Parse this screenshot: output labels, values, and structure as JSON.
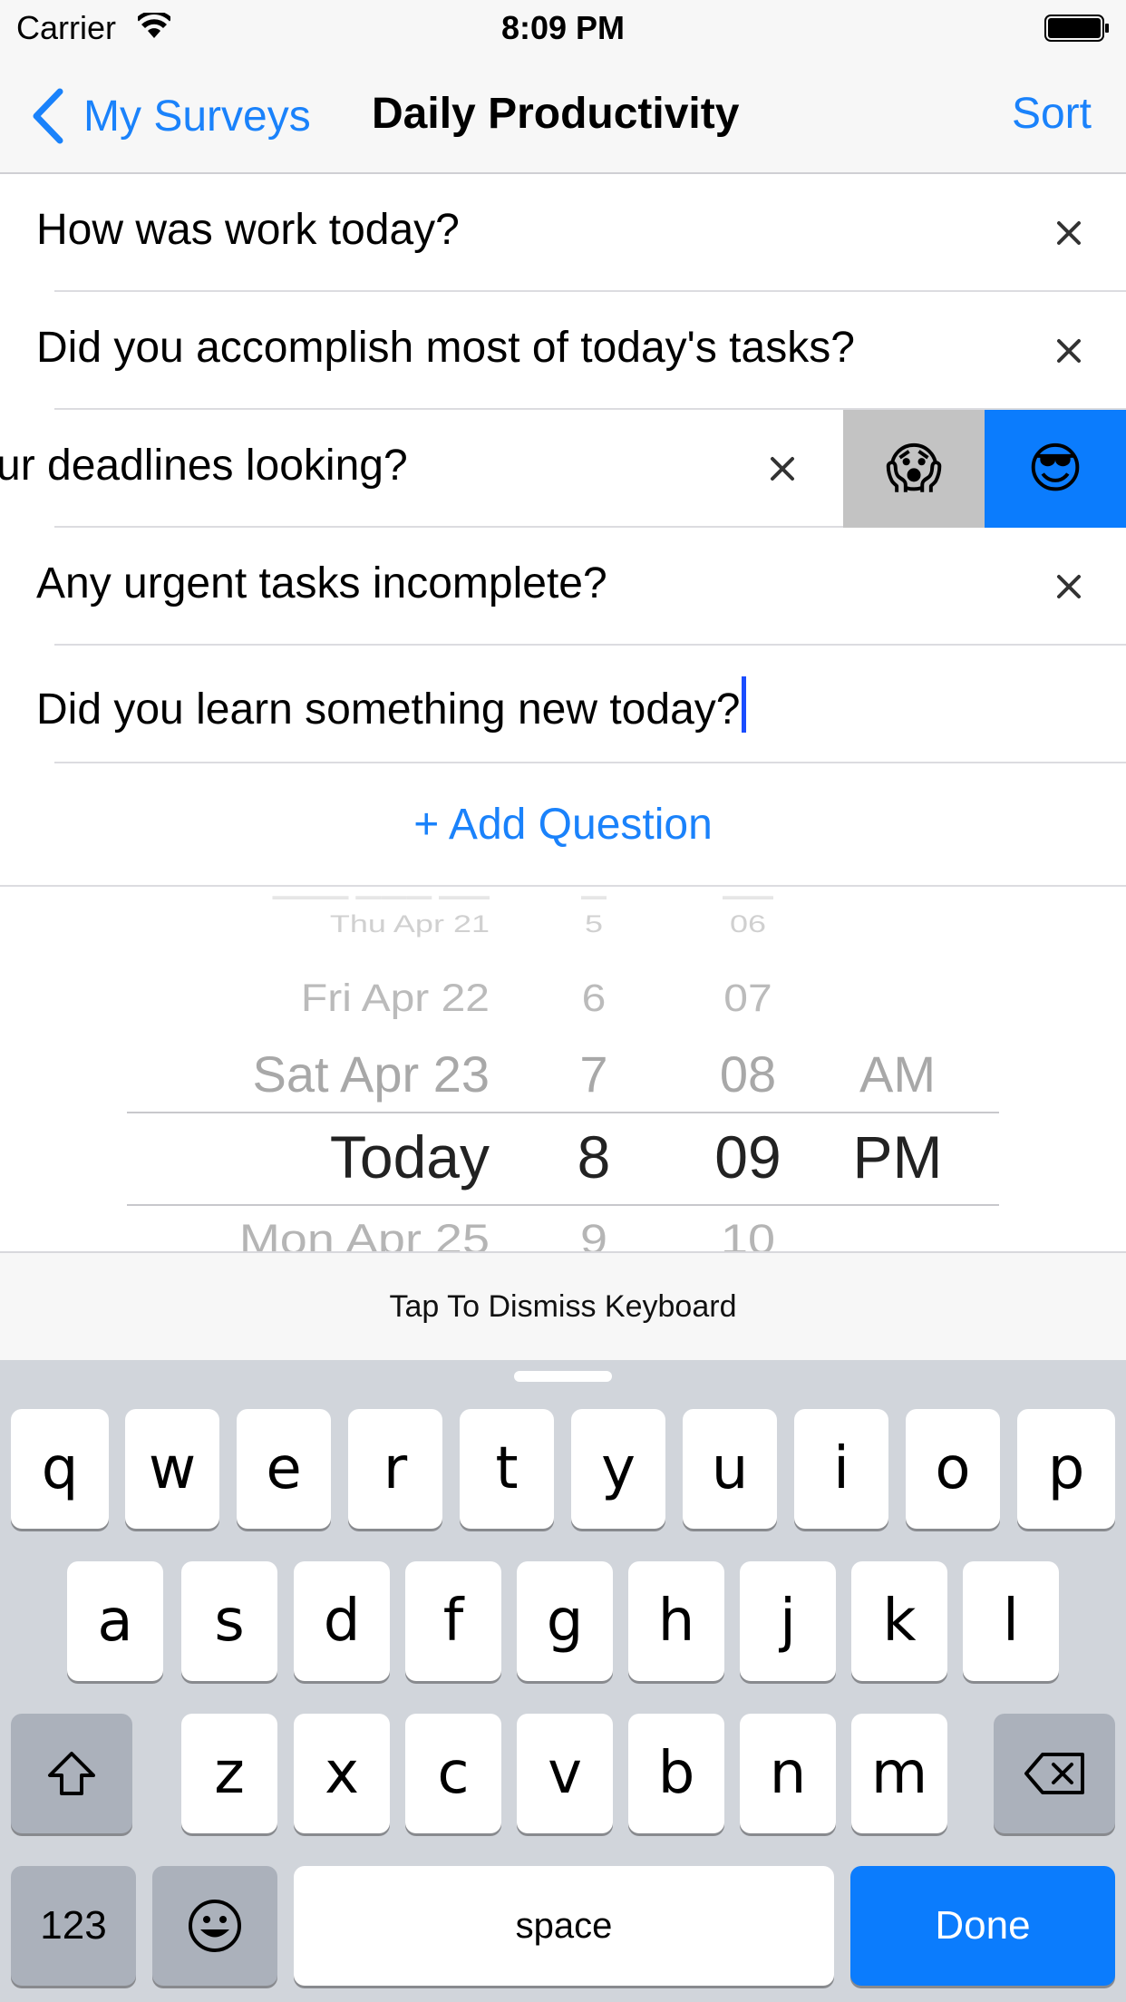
{
  "status_bar": {
    "carrier": "Carrier",
    "time": "8:09 PM"
  },
  "nav": {
    "back_label": "My Surveys",
    "title": "Daily Productivity",
    "right_label": "Sort"
  },
  "questions": [
    {
      "text": "How was work today?"
    },
    {
      "text": "Did you accomplish most of today's tasks?"
    },
    {
      "text": "ur deadlines looking?"
    },
    {
      "text": "Any urgent tasks incomplete?"
    },
    {
      "text": "Did you learn something new today?"
    }
  ],
  "swipe_actions": {
    "scared": "😱",
    "cool": "😎"
  },
  "add_question_label": "+ Add Question",
  "picker": {
    "day": [
      "Thu Apr 21",
      "Fri Apr 22",
      "Sat Apr 23",
      "Today",
      "Mon Apr 25"
    ],
    "hour": [
      "5",
      "6",
      "7",
      "8",
      "9"
    ],
    "minute": [
      "06",
      "07",
      "08",
      "09",
      "10"
    ],
    "ampm": [
      "AM",
      "PM"
    ]
  },
  "dismiss_label": "Tap To Dismiss Keyboard",
  "keyboard": {
    "row1": [
      "q",
      "w",
      "e",
      "r",
      "t",
      "y",
      "u",
      "i",
      "o",
      "p"
    ],
    "row2": [
      "a",
      "s",
      "d",
      "f",
      "g",
      "h",
      "j",
      "k",
      "l"
    ],
    "row3": [
      "z",
      "x",
      "c",
      "v",
      "b",
      "n",
      "m"
    ],
    "numbers_label": "123",
    "space_label": "space",
    "done_label": "Done"
  },
  "colors": {
    "accent": "#1a82fb",
    "done_key": "#0b7cfd",
    "swipe_gray": "#c3c3c3",
    "swipe_blue": "#0b7cfd"
  }
}
